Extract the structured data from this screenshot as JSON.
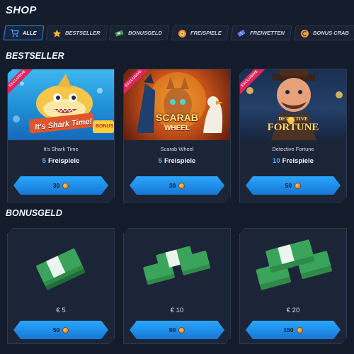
{
  "shop_title": "SHOP",
  "tabs": [
    {
      "label": "ALLE",
      "icon": "cart-icon",
      "active": true
    },
    {
      "label": "BESTSELLER",
      "icon": "star-icon",
      "active": false
    },
    {
      "label": "BONUSGELD",
      "icon": "cash-icon",
      "active": false
    },
    {
      "label": "FREISPIELE",
      "icon": "spin-icon",
      "active": false
    },
    {
      "label": "FREIWETTEN",
      "icon": "ticket-icon",
      "active": false
    },
    {
      "label": "BONUS CRAB",
      "icon": "coin-icon",
      "active": false
    }
  ],
  "bestseller": {
    "title": "BESTSELLER",
    "items": [
      {
        "badge": "EXCLUSIVE",
        "logo_text": "It's Shark Time!",
        "logo_sub": "BONUS",
        "name": "It's Shark Time",
        "spins": "5",
        "spins_label": "Freispiele",
        "price": "30"
      },
      {
        "badge": "EXCLUSIVE",
        "logo_text": "SCARAB",
        "logo_sub": "WHEEL",
        "name": "Scarab Wheel",
        "spins": "5",
        "spins_label": "Freispiele",
        "price": "30"
      },
      {
        "badge": "EXCLUSIVE",
        "logo_text": "DETECTIVE",
        "logo_sub": "FORTUNE",
        "name": "Detective Fortune",
        "spins": "10",
        "spins_label": "Freispiele",
        "price": "50"
      }
    ]
  },
  "bonusgeld": {
    "title": "BONUSGELD",
    "items": [
      {
        "amount": "€ 5",
        "price": "50"
      },
      {
        "amount": "€ 10",
        "price": "90"
      },
      {
        "amount": "€ 20",
        "price": "150"
      }
    ]
  },
  "colors": {
    "accent": "#2aa7ff",
    "background": "#141b2b",
    "card": "#1c2538",
    "badge": "#e0245e",
    "money_green": "#2f8a4a"
  }
}
